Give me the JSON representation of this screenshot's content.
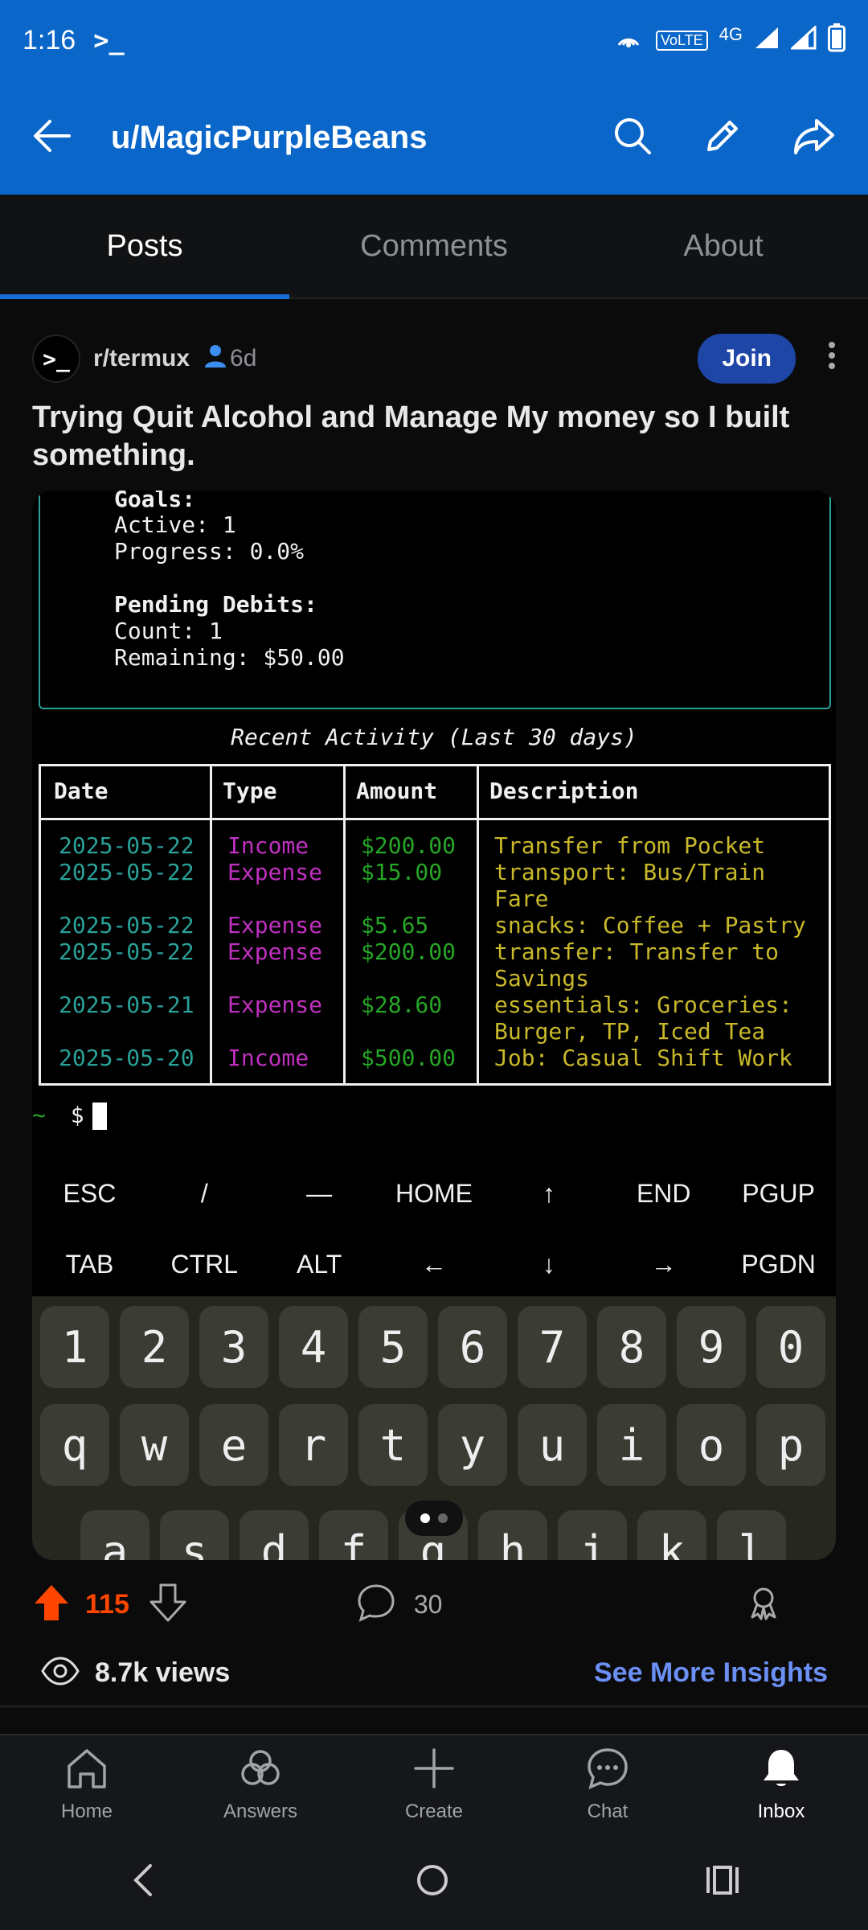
{
  "status": {
    "time": "1:16",
    "prompt_glyph": ">_",
    "network": "4G",
    "volte": "VoLTE"
  },
  "appbar": {
    "title": "u/MagicPurpleBeans"
  },
  "tabs": [
    {
      "label": "Posts"
    },
    {
      "label": "Comments"
    },
    {
      "label": "About"
    }
  ],
  "post": {
    "subreddit": "r/termux",
    "age": "6d",
    "join_label": "Join",
    "title": "Trying Quit Alcohol and Manage My money so I built something.",
    "avatar_glyph": ">_"
  },
  "terminal": {
    "summary": {
      "goals_header": "Goals:",
      "goals_active": "Active: 1",
      "goals_progress": "Progress: 0.0%",
      "debits_header": "Pending Debits:",
      "debits_count": "Count: 1",
      "debits_remaining": "Remaining: $50.00"
    },
    "caption": "Recent Activity (Last 30 days)",
    "headers": {
      "date": "Date",
      "type": "Type",
      "amount": "Amount",
      "description": "Description"
    },
    "rows": [
      {
        "date": "2025-05-22",
        "type": "Income",
        "amount": "$200.00",
        "description": "Transfer from Pocket"
      },
      {
        "date": "2025-05-22",
        "type": "Expense",
        "amount": "$15.00",
        "description": "transport: Bus/Train\nFare"
      },
      {
        "date": "2025-05-22",
        "type": "Expense",
        "amount": "$5.65",
        "description": "snacks: Coffee + Pastry"
      },
      {
        "date": "2025-05-22",
        "type": "Expense",
        "amount": "$200.00",
        "description": "transfer: Transfer to\nSavings"
      },
      {
        "date": "2025-05-21",
        "type": "Expense",
        "amount": "$28.60",
        "description": "essentials: Groceries:\nBurger, TP, Iced Tea"
      },
      {
        "date": "2025-05-20",
        "type": "Income",
        "amount": "$500.00",
        "description": "Job: Casual Shift Work"
      }
    ],
    "prompt_tilde": "~",
    "prompt_dollar": "$",
    "extra_keys_row1": [
      "ESC",
      "/",
      "—",
      "HOME",
      "↑",
      "END",
      "PGUP"
    ],
    "extra_keys_row2": [
      "TAB",
      "CTRL",
      "ALT",
      "←",
      "↓",
      "→",
      "PGDN"
    ]
  },
  "keyboard": {
    "numbers": [
      "1",
      "2",
      "3",
      "4",
      "5",
      "6",
      "7",
      "8",
      "9",
      "0"
    ],
    "row_q": [
      "q",
      "w",
      "e",
      "r",
      "t",
      "y",
      "u",
      "i",
      "o",
      "p"
    ],
    "row_a": [
      "a",
      "s",
      "d",
      "f",
      "g",
      "h",
      "j",
      "k",
      "l"
    ]
  },
  "actions": {
    "score": "115",
    "comments": "30"
  },
  "insights": {
    "views": "8.7k views",
    "link": "See More Insights"
  },
  "bottomnav": [
    {
      "label": "Home",
      "icon": "home-icon"
    },
    {
      "label": "Answers",
      "icon": "answers-icon"
    },
    {
      "label": "Create",
      "icon": "plus-icon"
    },
    {
      "label": "Chat",
      "icon": "chat-icon"
    },
    {
      "label": "Inbox",
      "icon": "bell-icon"
    }
  ],
  "colors": {
    "brand_blue": "#0a66c8",
    "upvote": "#ff4500",
    "link": "#6b8ff5",
    "teal": "#2aa198",
    "magenta": "#c030c0",
    "green": "#26a626",
    "yellow": "#c8b82a"
  }
}
